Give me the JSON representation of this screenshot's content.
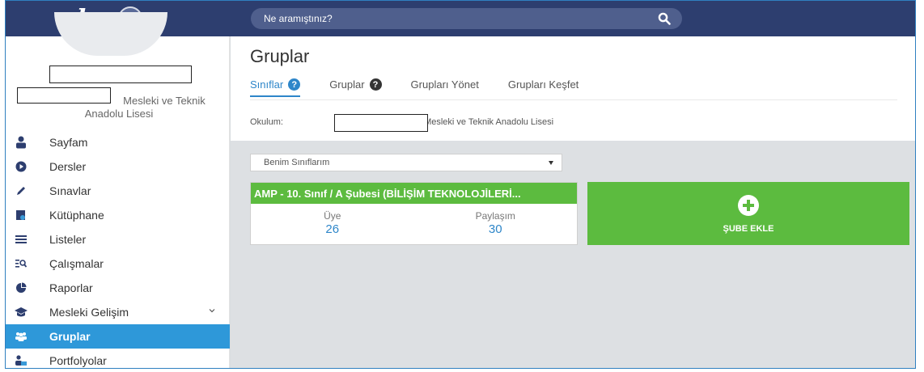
{
  "header": {
    "logo_text": "eba",
    "search_placeholder": "Ne aramıştınız?"
  },
  "profile": {
    "school_suffix": "Mesleki ve Teknik",
    "school_line2": "Anadolu Lisesi"
  },
  "sidebar": {
    "items": [
      {
        "label": "Sayfam",
        "icon": "user-icon"
      },
      {
        "label": "Dersler",
        "icon": "play-circle-icon"
      },
      {
        "label": "Sınavlar",
        "icon": "pencil-icon"
      },
      {
        "label": "Kütüphane",
        "icon": "library-icon"
      },
      {
        "label": "Listeler",
        "icon": "list-icon"
      },
      {
        "label": "Çalışmalar",
        "icon": "search-list-icon"
      },
      {
        "label": "Raporlar",
        "icon": "pie-chart-icon"
      },
      {
        "label": "Mesleki Gelişim",
        "icon": "graduation-cap-icon"
      },
      {
        "label": "Gruplar",
        "icon": "users-icon",
        "active": true
      },
      {
        "label": "Portfolyolar",
        "icon": "user-folder-icon"
      }
    ]
  },
  "main": {
    "title": "Gruplar",
    "tabs": [
      {
        "label": "Sınıflar",
        "help": true,
        "active": true
      },
      {
        "label": "Gruplar",
        "help": true
      },
      {
        "label": "Grupları Yönet"
      },
      {
        "label": "Grupları Keşfet"
      }
    ],
    "school_label": "Okulum:",
    "school_value": "Mesleki ve Teknik Anadolu Lisesi",
    "filter_selected": "Benim Sınıflarım",
    "class_card": {
      "title": "AMP - 10. Sınıf / A Şubesi (BİLİŞİM TEKNOLOJİLERİ...",
      "members_label": "Üye",
      "members_value": "26",
      "shares_label": "Paylaşım",
      "shares_value": "30"
    },
    "add_branch_label": "ŞUBE EKLE"
  },
  "colors": {
    "topbar": "#2d3e6f",
    "accent_blue": "#2e98d9",
    "green": "#5cbb3f"
  }
}
